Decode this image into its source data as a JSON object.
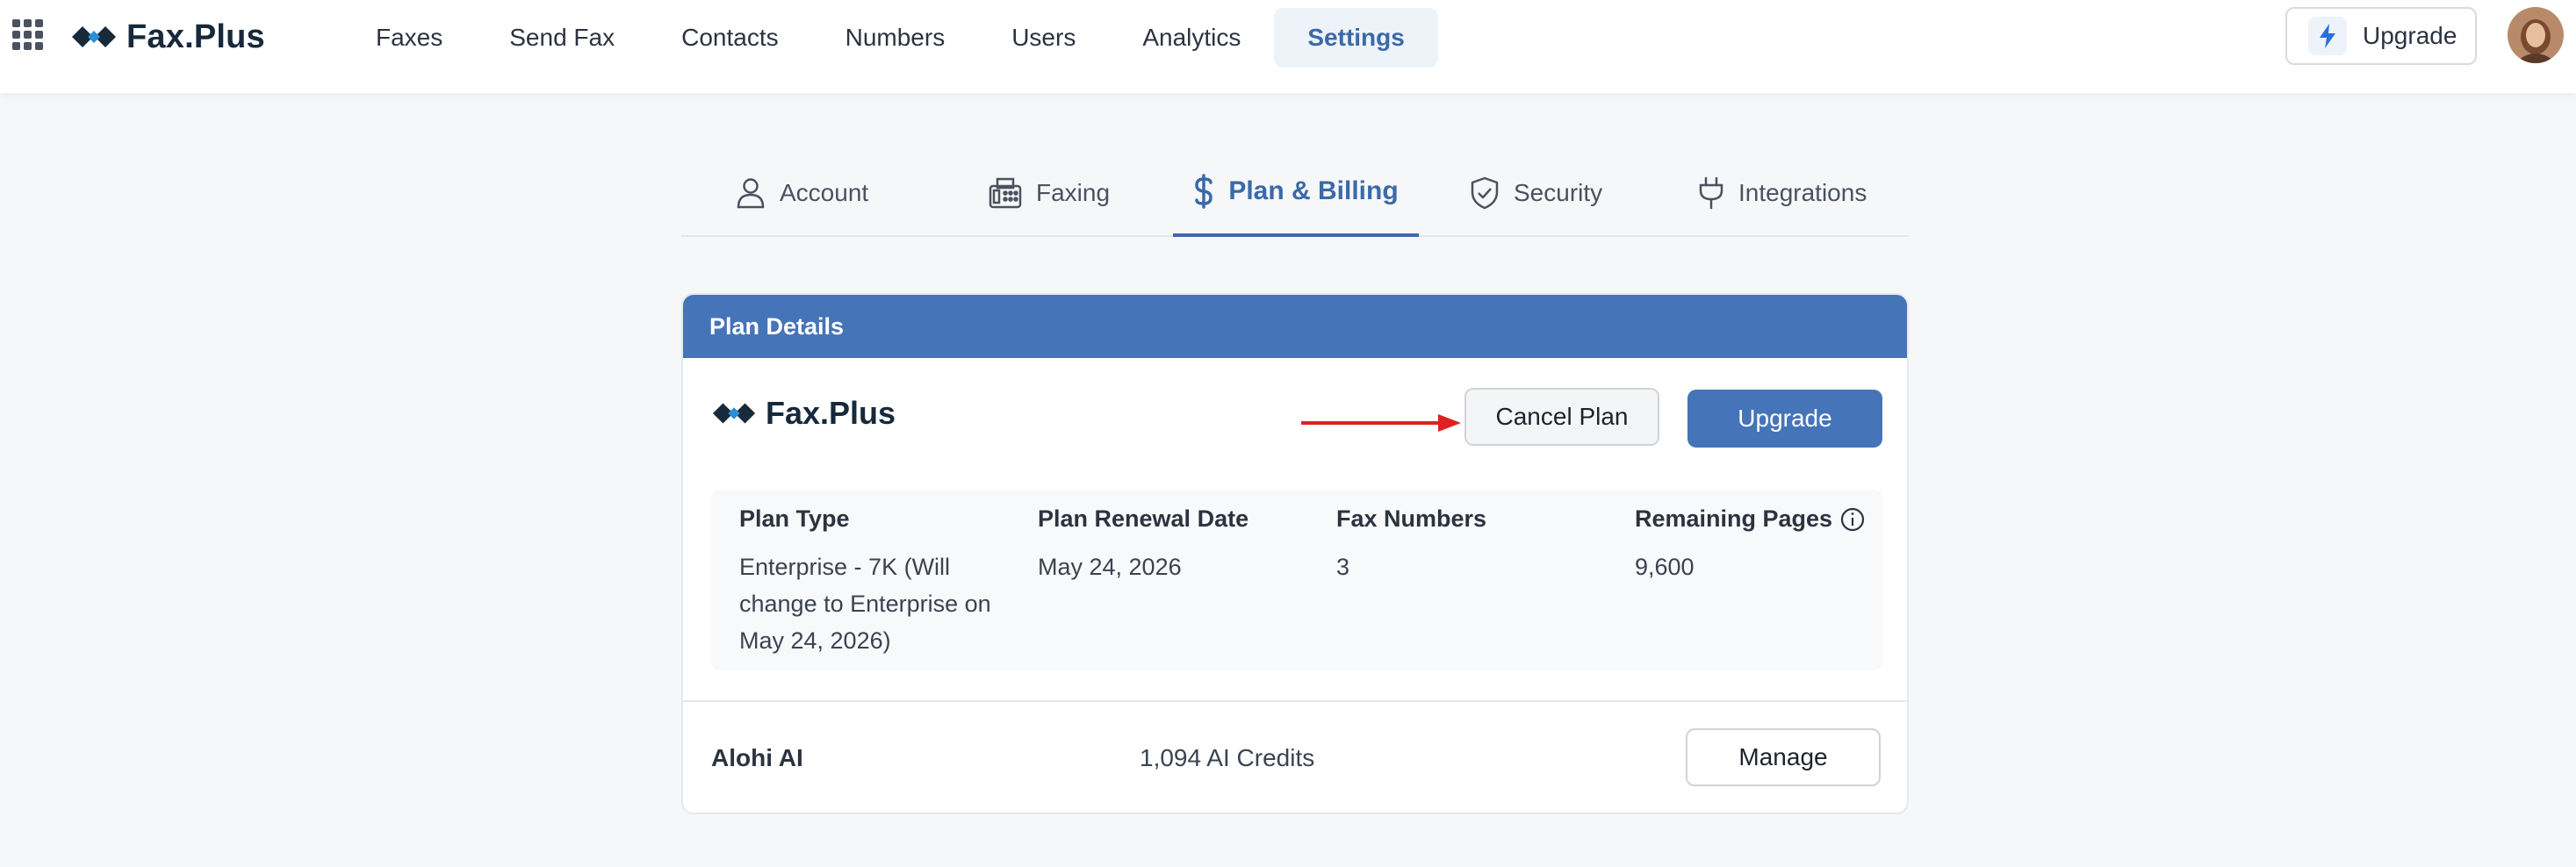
{
  "topbar": {
    "brand": "Fax.Plus",
    "nav": [
      {
        "label": "Faxes",
        "active": false
      },
      {
        "label": "Send Fax",
        "active": false
      },
      {
        "label": "Contacts",
        "active": false
      },
      {
        "label": "Numbers",
        "active": false
      },
      {
        "label": "Users",
        "active": false
      },
      {
        "label": "Analytics",
        "active": false
      },
      {
        "label": "Settings",
        "active": true
      }
    ],
    "upgrade_label": "Upgrade"
  },
  "tabs": [
    {
      "label": "Account",
      "icon": "user-icon"
    },
    {
      "label": "Faxing",
      "icon": "fax-icon"
    },
    {
      "label": "Plan & Billing",
      "icon": "dollar-icon",
      "active": true
    },
    {
      "label": "Security",
      "icon": "shield-check-icon"
    },
    {
      "label": "Integrations",
      "icon": "plug-icon"
    }
  ],
  "plan_card": {
    "header": "Plan Details",
    "brand": "Fax.Plus",
    "cancel_label": "Cancel Plan",
    "upgrade_label": "Upgrade",
    "columns": [
      {
        "heading": "Plan Type",
        "value": "Enterprise - 7K (Will change to Enterprise on May 24, 2026)"
      },
      {
        "heading": "Plan Renewal Date",
        "value": "May 24, 2026"
      },
      {
        "heading": "Fax Numbers",
        "value": "3"
      },
      {
        "heading": "Remaining Pages",
        "value": "9,600"
      }
    ],
    "ai": {
      "label": "Alohi AI",
      "credits": "1,094 AI Credits",
      "manage_label": "Manage"
    }
  },
  "colors": {
    "accent": "#4574b9",
    "arrow": "#e02020"
  }
}
